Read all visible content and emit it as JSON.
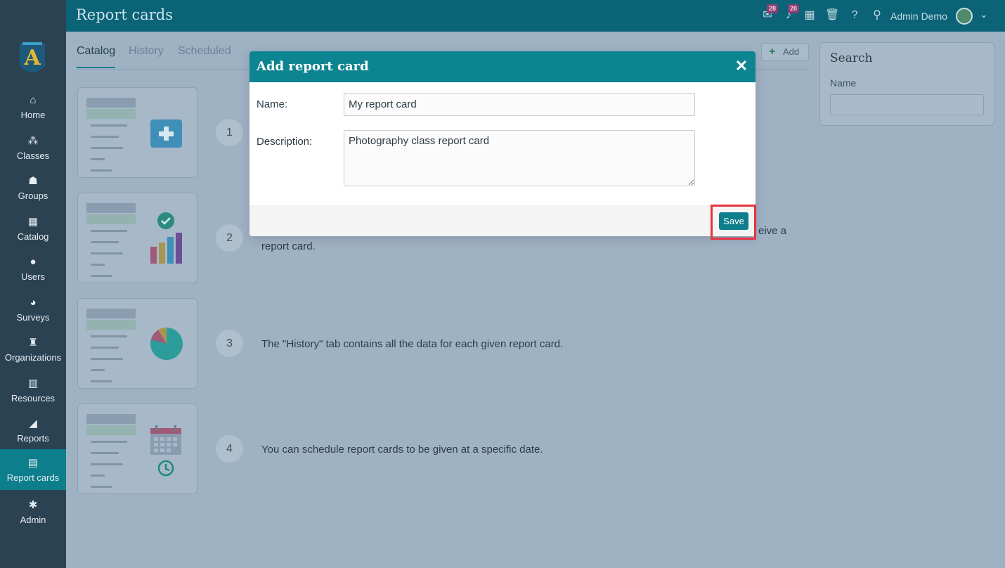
{
  "app": {
    "page_title": "Report cards"
  },
  "topbar": {
    "mail_count": "28",
    "notification_count": "20",
    "user_name": "Admin Demo"
  },
  "sidebar": {
    "items": [
      {
        "label": "Home",
        "icon": "home-icon",
        "glyph": "⌂"
      },
      {
        "label": "Classes",
        "icon": "classes-icon",
        "glyph": "⁂"
      },
      {
        "label": "Groups",
        "icon": "groups-icon",
        "glyph": "☗"
      },
      {
        "label": "Catalog",
        "icon": "catalog-icon",
        "glyph": "▦"
      },
      {
        "label": "Users",
        "icon": "user-icon",
        "glyph": "●"
      },
      {
        "label": "Surveys",
        "icon": "surveys-icon",
        "glyph": "◕"
      },
      {
        "label": "Organizations",
        "icon": "organizations-icon",
        "glyph": "♜"
      },
      {
        "label": "Resources",
        "icon": "resources-icon",
        "glyph": "▥"
      },
      {
        "label": "Reports",
        "icon": "reports-icon",
        "glyph": "◢"
      },
      {
        "label": "Report cards",
        "icon": "report-cards-icon",
        "glyph": "▤",
        "active": true
      },
      {
        "label": "Admin",
        "icon": "gear-icon",
        "glyph": "✱"
      }
    ]
  },
  "tabs": {
    "catalog": "Catalog",
    "history": "History",
    "scheduled": "Scheduled"
  },
  "toolbar": {
    "add_label": "Add"
  },
  "steps": [
    {
      "num": "1",
      "text": ""
    },
    {
      "num": "2",
      "text": "report card.",
      "text_tail": "eive a"
    },
    {
      "num": "3",
      "text": "The \"History\" tab contains all the data for each given report card."
    },
    {
      "num": "4",
      "text": "You can schedule report cards to be given at a specific date."
    }
  ],
  "search": {
    "title": "Search",
    "name_label": "Name",
    "name_value": ""
  },
  "modal": {
    "title": "Add report card",
    "name_label": "Name:",
    "name_value": "My report card",
    "description_label": "Description:",
    "description_value": "Photography class report card",
    "save_label": "Save"
  },
  "colors": {
    "accent": "#0d7e8c",
    "topbar": "#0b6378",
    "sidebar": "#2b4253",
    "highlight": "#e8323c"
  }
}
